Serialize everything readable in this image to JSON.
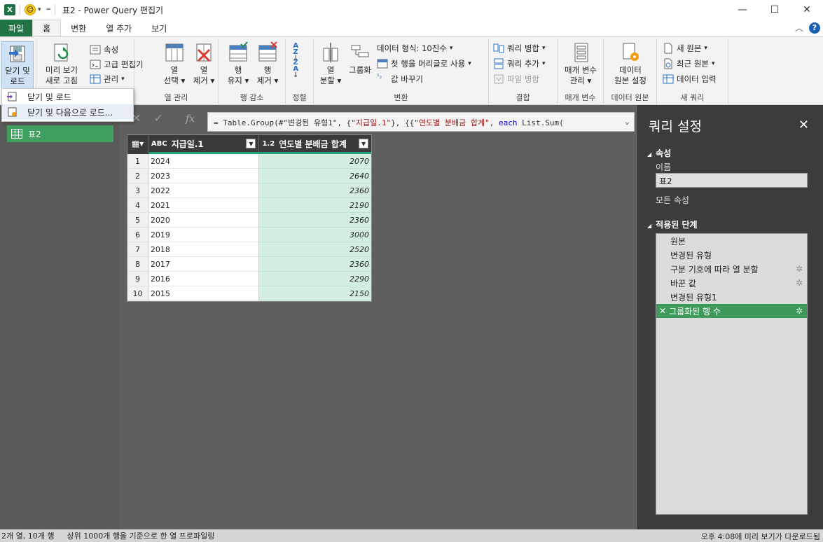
{
  "window": {
    "app_icon": "X",
    "title": "표2 - Power Query 편집기"
  },
  "tabs": [
    "파일",
    "홈",
    "변환",
    "열 추가",
    "보기"
  ],
  "ribbon": {
    "close_load": "닫기 및\n로드",
    "refresh_preview_1": "미리 보기",
    "refresh_preview_2": "새로 고침",
    "properties": "속성",
    "advanced_editor": "고급 편집기",
    "manage": "관리",
    "choose_columns_1": "열",
    "choose_columns_2": "선택",
    "remove_columns_1": "열",
    "remove_columns_2": "제거",
    "columns_group": "열 관리",
    "keep_rows_1": "행",
    "keep_rows_2": "유지",
    "remove_rows_1": "행",
    "remove_rows_2": "제거",
    "reduce_rows_group": "행 감소",
    "sort_group": "정렬",
    "split_column_1": "열",
    "split_column_2": "분할",
    "group_by": "그룹화",
    "data_type": "데이터 형식: 10진수",
    "use_first_row": "첫 행을 머리글로 사용",
    "replace_values": "값 바꾸기",
    "transform_group": "변환",
    "merge_queries": "쿼리 병합",
    "append_queries": "쿼리 추가",
    "combine_files": "파일 병합",
    "combine_group": "결합",
    "manage_params_1": "매개 변수",
    "manage_params_2": "관리",
    "params_group": "매개 변수",
    "data_source_1": "데이터",
    "data_source_2": "원본 설정",
    "data_source_group": "데이터 원본",
    "new_source": "새 원본",
    "recent_sources": "최근 원본",
    "enter_data": "데이터 입력",
    "new_query_group": "새 쿼리"
  },
  "dropdown": {
    "item1": "닫기 및 로드",
    "item2": "닫기 및 다음으로 로드..."
  },
  "queries": [
    {
      "name": "표2"
    }
  ],
  "formula": {
    "prefix": "= Table.Group(#\"변경된 유형1\", {",
    "str1": "\"지급일.1\"",
    "mid": "}, {{",
    "str2": "\"연도별 분배금 합계\"",
    "mid2": ", ",
    "kw": "each",
    "suffix": " List.Sum("
  },
  "table": {
    "columns": [
      {
        "type": "ABC",
        "name": "지급일.1"
      },
      {
        "type": "1.2",
        "name": "연도별 분배금 합계"
      }
    ],
    "rows": [
      [
        "1",
        "2024",
        "2070"
      ],
      [
        "2",
        "2023",
        "2640"
      ],
      [
        "3",
        "2022",
        "2360"
      ],
      [
        "4",
        "2021",
        "2190"
      ],
      [
        "5",
        "2020",
        "2360"
      ],
      [
        "6",
        "2019",
        "3000"
      ],
      [
        "7",
        "2018",
        "2520"
      ],
      [
        "8",
        "2017",
        "2360"
      ],
      [
        "9",
        "2016",
        "2290"
      ],
      [
        "10",
        "2015",
        "2150"
      ]
    ]
  },
  "settings": {
    "title": "쿼리 설정",
    "properties_header": "속성",
    "name_label": "이름",
    "name_value": "표2",
    "all_properties": "모든 속성",
    "steps_header": "적용된 단계",
    "steps": [
      {
        "label": "원본",
        "gear": false,
        "selected": false
      },
      {
        "label": "변경된 유형",
        "gear": false,
        "selected": false
      },
      {
        "label": "구분 기호에 따라 열 분할",
        "gear": true,
        "selected": false
      },
      {
        "label": "바꾼 값",
        "gear": true,
        "selected": false
      },
      {
        "label": "변경된 유형1",
        "gear": false,
        "selected": false
      },
      {
        "label": "그룹화된 행 수",
        "gear": true,
        "selected": true
      }
    ]
  },
  "status": {
    "left1": "2개 열, 10개 행",
    "left2": "상위 1000개 행을 기준으로 한 열 프로파일링",
    "right": "오후 4:08에 미리 보기가 다운로드됨"
  },
  "colors": {
    "accent": "#217346",
    "selected_step": "#3d9a5b",
    "value_column": "#d4efe2"
  }
}
